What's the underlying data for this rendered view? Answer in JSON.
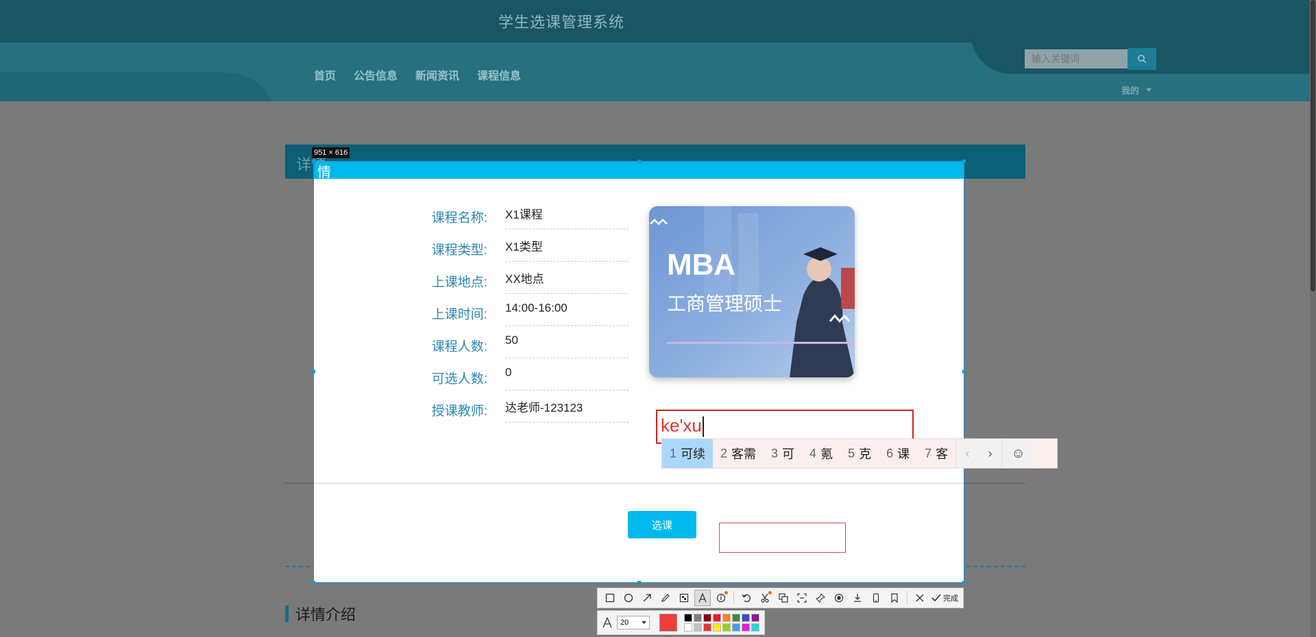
{
  "app": {
    "title": "学生选课管理系统"
  },
  "nav": {
    "items": [
      "首页",
      "公告信息",
      "新闻资讯",
      "课程信息"
    ]
  },
  "search": {
    "placeholder": "输入关键词"
  },
  "user_menu": {
    "label": "我的"
  },
  "page": {
    "detail_header": "详情",
    "intro_title": "详情介绍"
  },
  "capture": {
    "size_label": "951 × 616",
    "header_fragment": "情"
  },
  "course": {
    "fields": [
      {
        "label": "课程名称:",
        "value": "X1课程"
      },
      {
        "label": "课程类型:",
        "value": "X1类型"
      },
      {
        "label": "上课地点:",
        "value": "XX地点"
      },
      {
        "label": "上课时间:",
        "value": "14:00-16:00"
      },
      {
        "label": "课程人数:",
        "value": "50"
      },
      {
        "label": "可选人数:",
        "value": "0"
      },
      {
        "label": "授课教师:",
        "value": "达老师-123123"
      }
    ],
    "image": {
      "title": "MBA",
      "subtitle": "工商管理硕士"
    },
    "select_button": "选课"
  },
  "annotation": {
    "typed_text": "ke'xu",
    "color": "#e23232"
  },
  "ime": {
    "candidates": [
      {
        "index": "1",
        "text": "可续"
      },
      {
        "index": "2",
        "text": "客需"
      },
      {
        "index": "3",
        "text": "可"
      },
      {
        "index": "4",
        "text": "氪"
      },
      {
        "index": "5",
        "text": "克"
      },
      {
        "index": "6",
        "text": "课"
      },
      {
        "index": "7",
        "text": "客"
      }
    ],
    "active_index": 0
  },
  "toolbar": {
    "done_label": "完成",
    "font_size": "20",
    "current_color": "#f03c3c",
    "swatches": [
      "#000000",
      "#7f7f7f",
      "#880015",
      "#ed1c24",
      "#ff7f27",
      "#3d8b3d",
      "#3f48cc",
      "#8e1a8e",
      "#ffffff",
      "#c3c3c3",
      "#e83333",
      "#ffee00",
      "#9bd21d",
      "#3ca0f0",
      "#e020d8",
      "#2ed3d3"
    ]
  },
  "colors": {
    "accent": "#00b8ec",
    "header_dark": "#1a5563",
    "label_blue": "#2c89b1"
  }
}
